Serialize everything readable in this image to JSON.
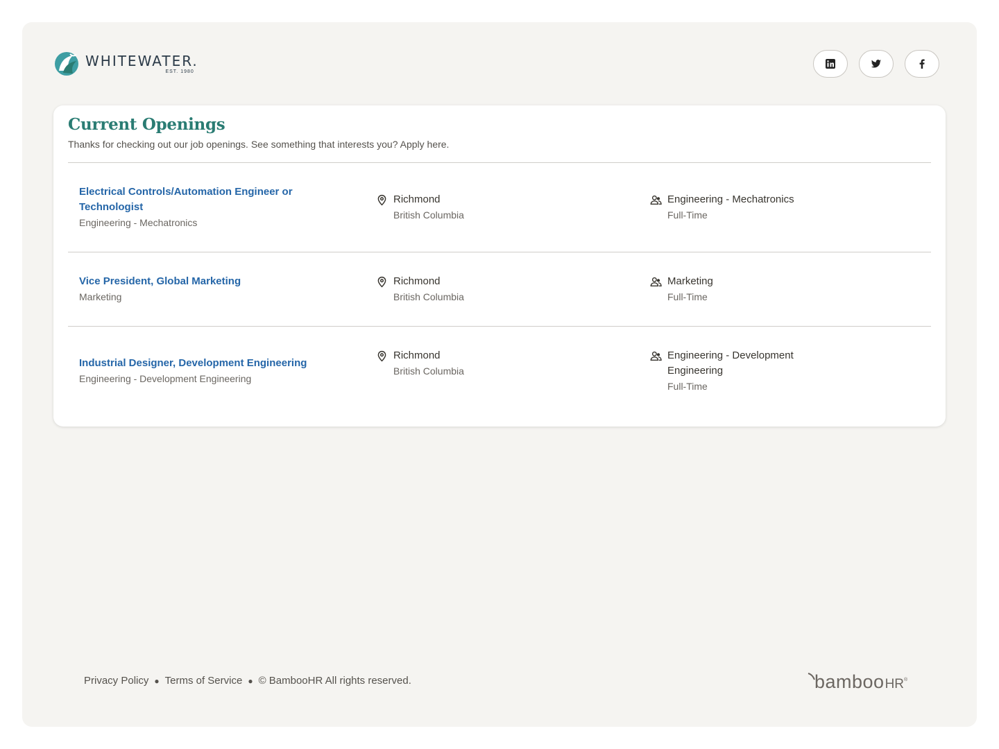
{
  "brand": {
    "name": "WHITEWATER.",
    "est": "EST. 1980"
  },
  "socials": [
    {
      "icon": "linkedin-icon"
    },
    {
      "icon": "twitter-icon"
    },
    {
      "icon": "facebook-icon"
    }
  ],
  "openings": {
    "title": "Current Openings",
    "subtitle": "Thanks for checking out our job openings. See something that interests you? Apply here.",
    "jobs": [
      {
        "title_line1": "Electrical Controls/Automation Engineer or",
        "title_line2": "Technologist",
        "department": "Engineering - Mechatronics",
        "city": "Richmond",
        "region": "British Columbia",
        "dept_line1": "Engineering - Mechatronics",
        "dept_line2": "",
        "type": "Full-Time"
      },
      {
        "title_line1": "Vice President, Global Marketing",
        "title_line2": "",
        "department": "Marketing",
        "city": "Richmond",
        "region": "British Columbia",
        "dept_line1": "Marketing",
        "dept_line2": "",
        "type": "Full-Time"
      },
      {
        "title_line1": "Industrial Designer, Development Engineering",
        "title_line2": "",
        "department": "Engineering - Development Engineering",
        "city": "Richmond",
        "region": "British Columbia",
        "dept_line1": "Engineering - Development",
        "dept_line2": "Engineering",
        "type": "Full-Time"
      }
    ]
  },
  "footer": {
    "privacy": "Privacy Policy",
    "terms": "Terms of Service",
    "copyright": "© BambooHR All rights reserved.",
    "powered_word": "bamboo",
    "powered_hr": "HR",
    "powered_mark": "®"
  },
  "colors": {
    "accent_teal": "#2a7c73",
    "link_blue": "#2566a8",
    "page_bg": "#f5f4f1"
  }
}
